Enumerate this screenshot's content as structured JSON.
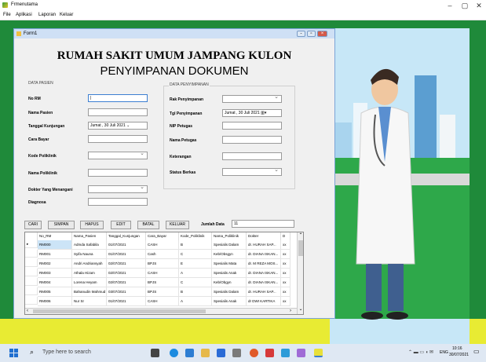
{
  "window": {
    "title": "Frmenutama",
    "minimize": "–",
    "maximize": "▢",
    "close": "✕"
  },
  "menu": [
    "File",
    "Aplikasi",
    "Laporan",
    "Keluar"
  ],
  "form": {
    "title": "Form1",
    "heading1": "RUMAH SAKIT UMUM JAMPANG KULON",
    "heading2": "PENYIMPANAN DOKUMEN"
  },
  "pasien": {
    "group": "DATA PASIEN",
    "fields": [
      {
        "label": "No RM",
        "value": "|",
        "type": "text"
      },
      {
        "label": "Nama Pasien",
        "value": "",
        "type": "text"
      },
      {
        "label": "Tanggal Kunjungan",
        "value": "Jumat , 30     Juli     2021 ⌄",
        "type": "date"
      },
      {
        "label": "Cara Bayar",
        "value": "",
        "type": "text"
      },
      {
        "label": "Kode Poliklinik",
        "value": "",
        "type": "select"
      },
      {
        "label": "Nama Poliklinik",
        "value": "",
        "type": "text"
      },
      {
        "label": "Dokter Yang Menangani",
        "value": "",
        "type": "select"
      },
      {
        "label": "Diagnosa",
        "value": "",
        "type": "text"
      }
    ]
  },
  "penyimpanan": {
    "group": "DATA PENYIMPANAN",
    "fields": [
      {
        "label": "Rak Penyimpanan",
        "value": "",
        "type": "select"
      },
      {
        "label": "Tgl Penyimpanan",
        "value": "Jumat , 30     Juli     2021 ▥▾",
        "type": "date"
      },
      {
        "label": "NIP Petugas",
        "value": "",
        "type": "text"
      },
      {
        "label": "Nama Petugas",
        "value": "",
        "type": "text"
      },
      {
        "label": "Keterangan",
        "value": "",
        "type": "text"
      },
      {
        "label": "Status Berkas",
        "value": "",
        "type": "select"
      }
    ]
  },
  "buttons": [
    "CARI",
    "SIMPAN",
    "HAPUS",
    "EDIT",
    "BATAL",
    "KELUAR"
  ],
  "jumlah": {
    "label": "Jumlah Data",
    "value": "11"
  },
  "grid": {
    "columns": [
      "No_RM",
      "Nama_Pasien",
      "Tanggal_Kunjungan",
      "Cara_Bayar",
      "Kode_Poliklinik",
      "Nama_Poliklinik",
      "Dokter",
      "D"
    ],
    "rows": [
      [
        "RM000",
        "Admda Safabila",
        "01/07/2021",
        "CASH",
        "B",
        "Spesialis Dalam",
        "dr. HURAH SAP...",
        "xx"
      ],
      [
        "RM001",
        "Syifa Nauna",
        "01/07/2021",
        "Cash",
        "C",
        "Keb/Obsgyn",
        "dr. DIANA ISKAN...",
        "xx"
      ],
      [
        "RM002",
        "Andri Andriansyah",
        "02/07/2021",
        "BPJS",
        "E",
        "Spesialis Mata",
        "dr. M REZA MOS...",
        "xx"
      ],
      [
        "RM003",
        "Athala Hizam",
        "02/07/2021",
        "CASH",
        "A",
        "Spesialis Anak",
        "dr. DIANA ISKAN...",
        "xx"
      ],
      [
        "RM004",
        "Lorena Heyam",
        "02/07/2021",
        "BPJS",
        "C",
        "Keb/Obgyn",
        "dr. DIANA ISKAN...",
        "xx"
      ],
      [
        "RM005",
        "Bahanudin Mahmud",
        "03/07/2021",
        "BPJS",
        "B",
        "Spesialis Dalam",
        "dr. HURAH SAP...",
        "xx"
      ],
      [
        "RM006",
        "Nur Sr",
        "01/07/2021",
        "CASH",
        "A",
        "Spesialis Anak",
        "dr DWI KARTIKA",
        "xx"
      ]
    ]
  },
  "taskbar": {
    "search": "Type here to search",
    "lang": "ENG",
    "time": "10:16",
    "date": "30/07/2021"
  },
  "icons": {
    "window": "app-icon",
    "start": "windows-start-icon",
    "search": "search-icon"
  }
}
